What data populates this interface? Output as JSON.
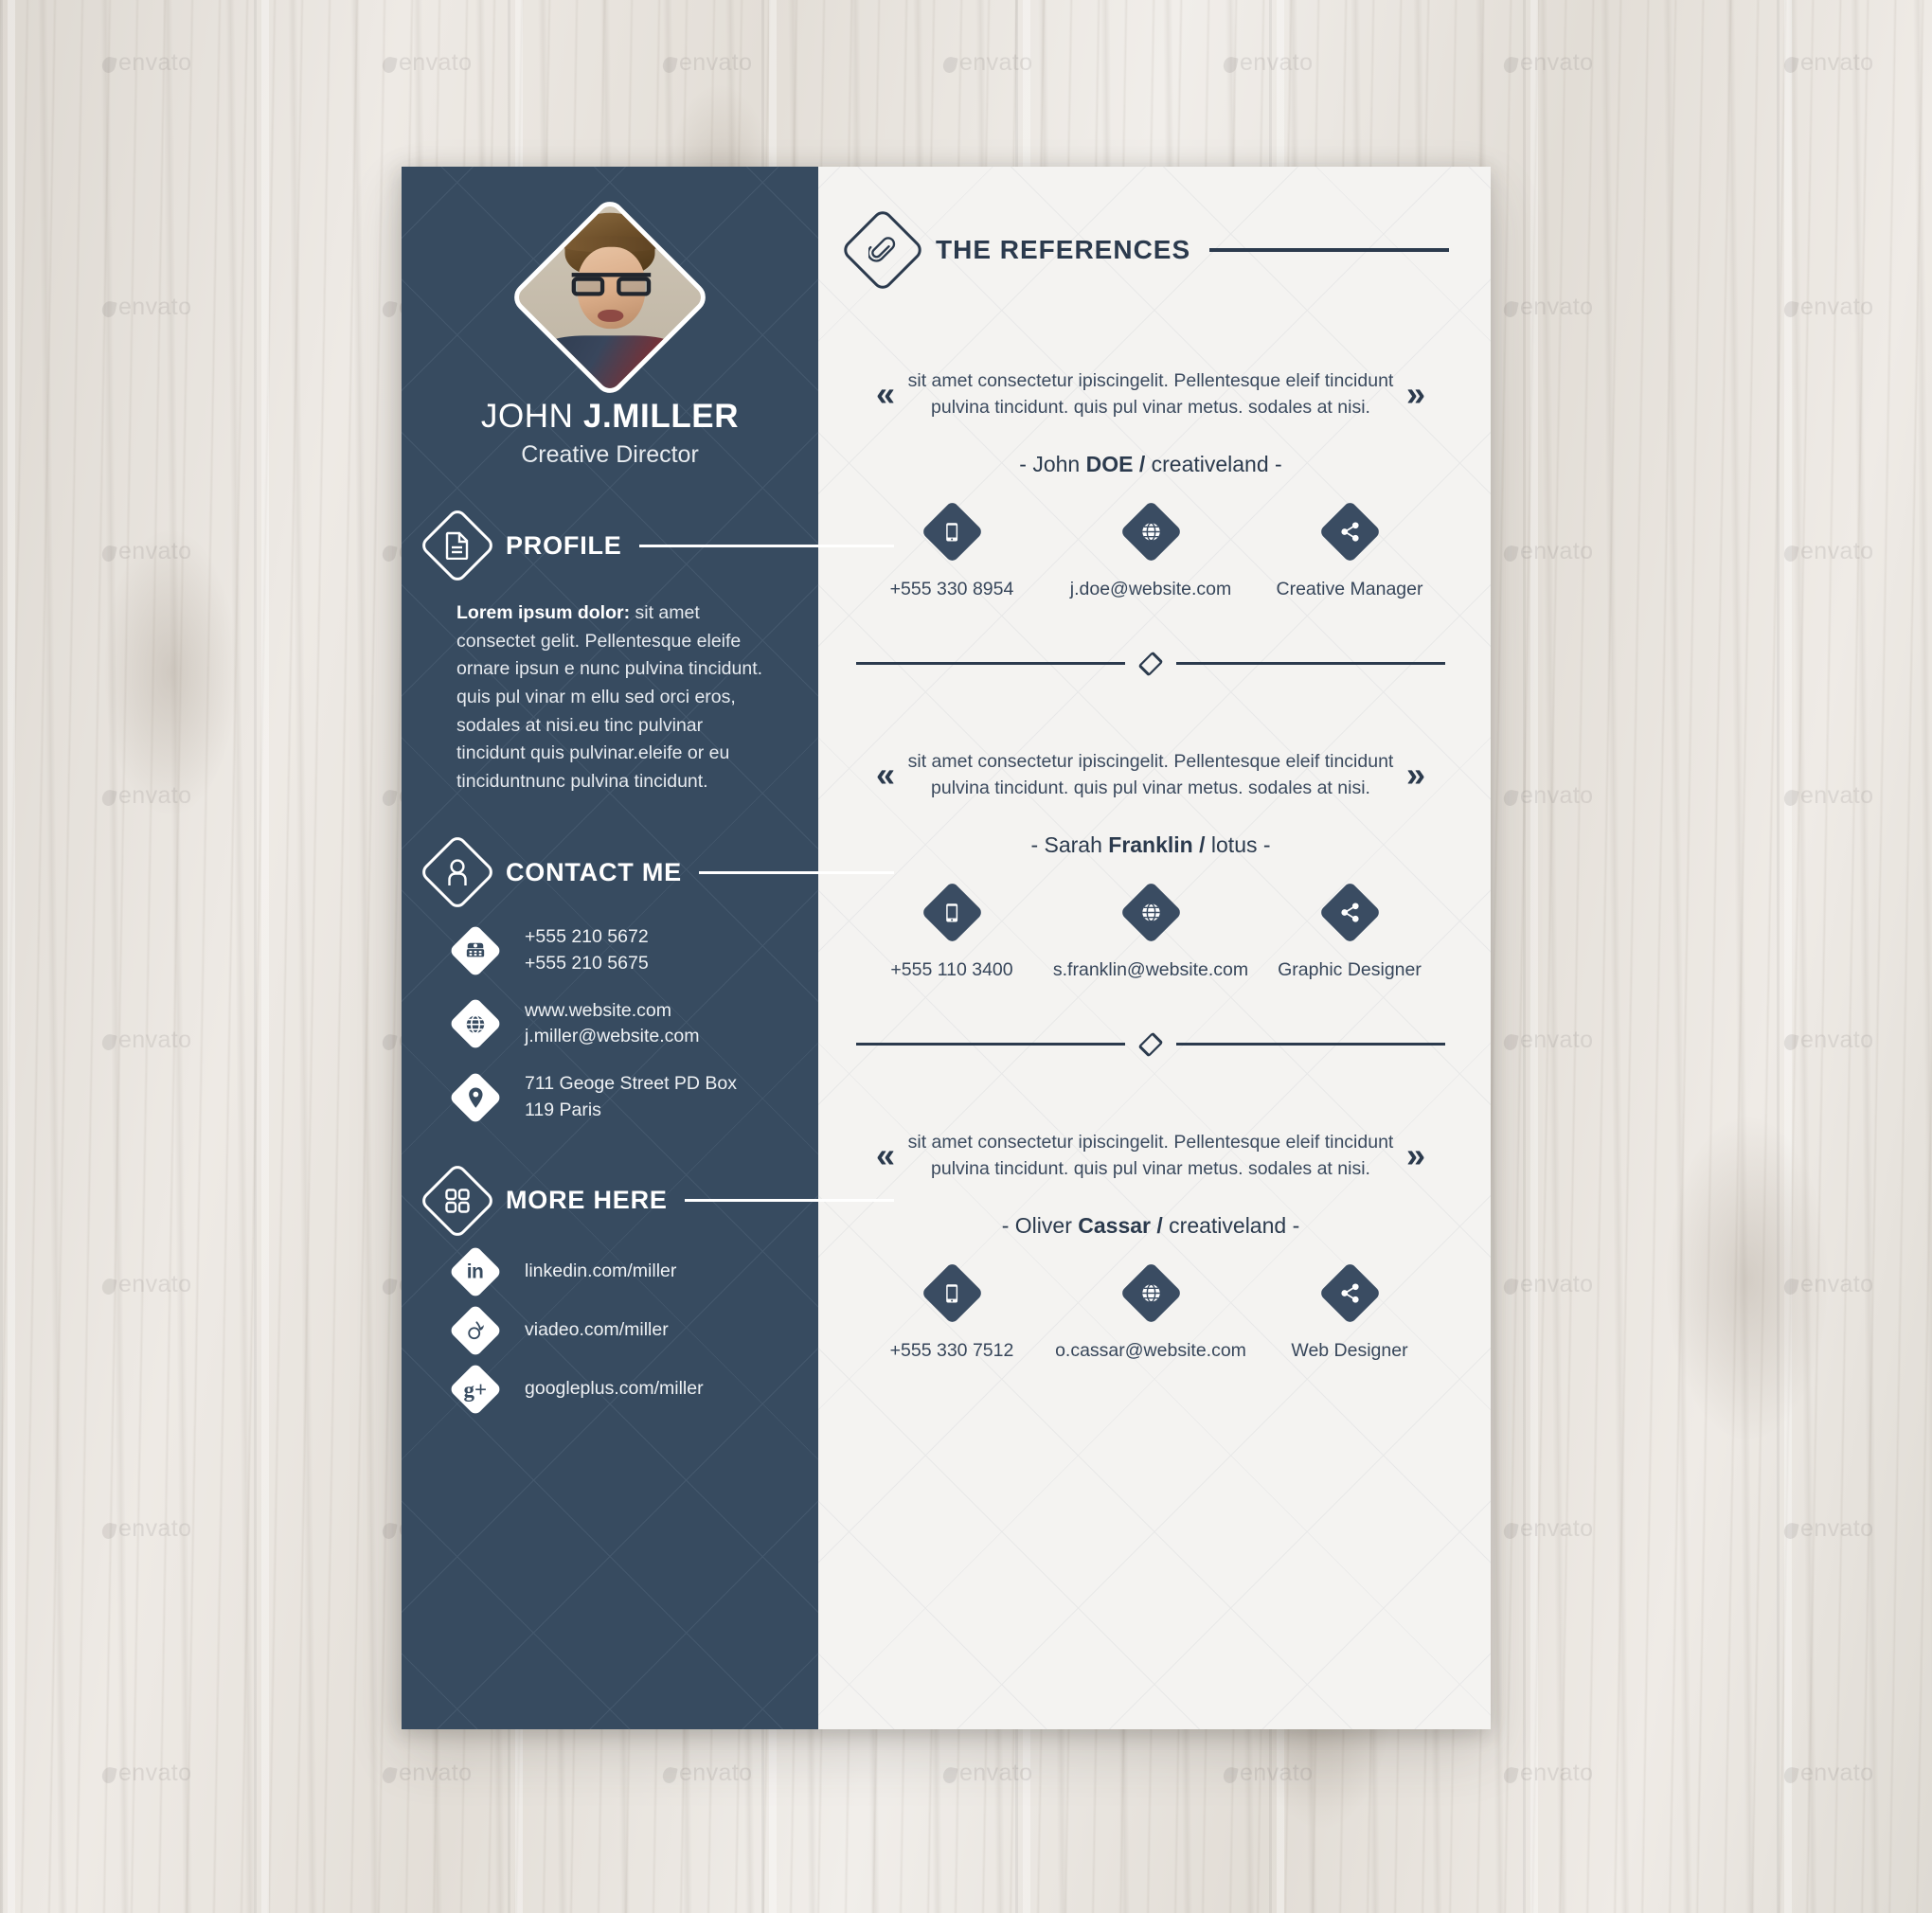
{
  "watermark": {
    "text": "envato"
  },
  "theme": {
    "dark_navy": "#374b60",
    "ink": "#2b3a4d",
    "paper": "#f4f3f1",
    "white": "#ffffff"
  },
  "left_column": {
    "photo_alt": "portrait-photo",
    "name_first": "JOHN",
    "name_last": "J.MILLER",
    "role": "Creative Director",
    "sections": [
      {
        "id": "profile",
        "icon": "document-icon",
        "title": "PROFILE"
      },
      {
        "id": "contact",
        "icon": "person-icon",
        "title": "CONTACT ME"
      },
      {
        "id": "more",
        "icon": "grid-icon",
        "title": "MORE HERE"
      }
    ],
    "profile": {
      "lead": "Lorem ipsum dolor:",
      "body": " sit amet consectet gelit. Pellentesque eleife ornare ipsun e nunc pulvina tincidunt. quis pul vinar m ellu sed orci eros, sodales at nisi.eu tinc pulvinar tincidunt quis pulvinar.eleife or eu tinciduntnunc pulvina tincidunt."
    },
    "contact_rows": [
      {
        "icon": "telephone-icon",
        "line1": "+555 210 5672",
        "line2": "+555 210 5675"
      },
      {
        "icon": "globe-icon",
        "line1": "www.website.com",
        "line2": "j.miller@website.com"
      },
      {
        "icon": "location-pin-icon",
        "line1": "711 Geoge Street PD Box",
        "line2": "119 Paris"
      }
    ],
    "social_rows": [
      {
        "icon": "linkedin-icon",
        "label": "linkedin.com/miller"
      },
      {
        "icon": "viadeo-icon",
        "label": "viadeo.com/miller"
      },
      {
        "icon": "googleplus-icon",
        "label": "googleplus.com/miller"
      }
    ]
  },
  "right_column": {
    "header": {
      "icon": "paperclip-icon",
      "title": "THE REFERENCES"
    },
    "quote_open": "«",
    "quote_close": "»",
    "references": [
      {
        "quote": "sit amet consectetur ipiscingelit. Pellentesque eleif tincidunt pulvina tincidunt. quis pul vinar metus. sodales at nisi.",
        "dash_left": "-",
        "name_first": "John",
        "name_last": "DOE",
        "slash": "/",
        "company": "creativeland",
        "dash_right": "-",
        "contacts": [
          {
            "icon": "mobile-icon",
            "label": "+555 330 8954"
          },
          {
            "icon": "globe-icon",
            "label": "j.doe@website.com"
          },
          {
            "icon": "share-icon",
            "label": "Creative Manager"
          }
        ]
      },
      {
        "quote": "sit amet consectetur ipiscingelit. Pellentesque eleif tincidunt pulvina tincidunt. quis pul vinar metus. sodales at nisi.",
        "dash_left": "-",
        "name_first": "Sarah",
        "name_last": "Franklin",
        "slash": "/",
        "company": "lotus",
        "dash_right": "-",
        "contacts": [
          {
            "icon": "mobile-icon",
            "label": "+555 110 3400"
          },
          {
            "icon": "globe-icon",
            "label": "s.franklin@website.com"
          },
          {
            "icon": "share-icon",
            "label": "Graphic Designer"
          }
        ]
      },
      {
        "quote": "sit amet consectetur ipiscingelit. Pellentesque eleif tincidunt pulvina tincidunt. quis pul vinar metus. sodales at nisi.",
        "dash_left": "-",
        "name_first": "Oliver",
        "name_last": "Cassar",
        "slash": "/",
        "company": "creativeland",
        "dash_right": "-",
        "contacts": [
          {
            "icon": "mobile-icon",
            "label": "+555 330 7512"
          },
          {
            "icon": "globe-icon",
            "label": "o.cassar@website.com"
          },
          {
            "icon": "share-icon",
            "label": "Web Designer"
          }
        ]
      }
    ]
  }
}
